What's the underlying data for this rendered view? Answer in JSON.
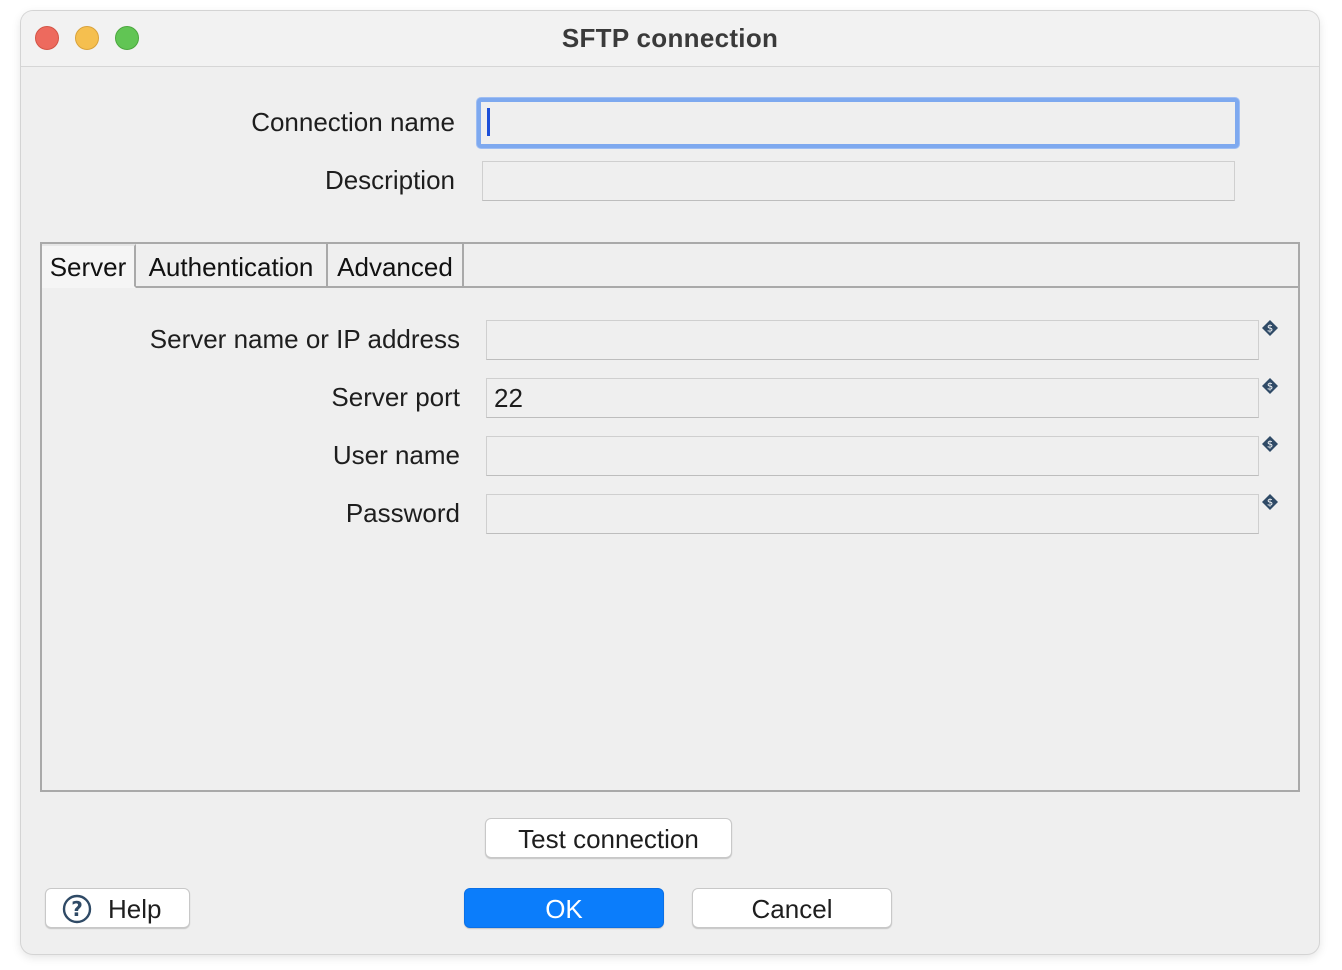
{
  "window": {
    "title": "SFTP connection"
  },
  "form": {
    "connection_name_label": "Connection name",
    "connection_name_value": "",
    "description_label": "Description",
    "description_value": ""
  },
  "tabs": [
    {
      "label": "Server",
      "active": true
    },
    {
      "label": "Authentication",
      "active": false
    },
    {
      "label": "Advanced",
      "active": false
    }
  ],
  "server": {
    "host_label": "Server name or IP address",
    "host_value": "",
    "port_label": "Server port",
    "port_value": "22",
    "user_label": "User name",
    "user_value": "",
    "password_label": "Password",
    "password_value": ""
  },
  "buttons": {
    "test_connection": "Test connection",
    "help": "Help",
    "ok": "OK",
    "cancel": "Cancel"
  },
  "icons": {
    "variable": "variable-dollar-icon",
    "help": "help-question-icon"
  },
  "colors": {
    "accent": "#0b7dfb",
    "focus_ring": "#7ea9ef",
    "close": "#ed6a5e",
    "minimize": "#f5bf4f",
    "maximize": "#61c554"
  }
}
